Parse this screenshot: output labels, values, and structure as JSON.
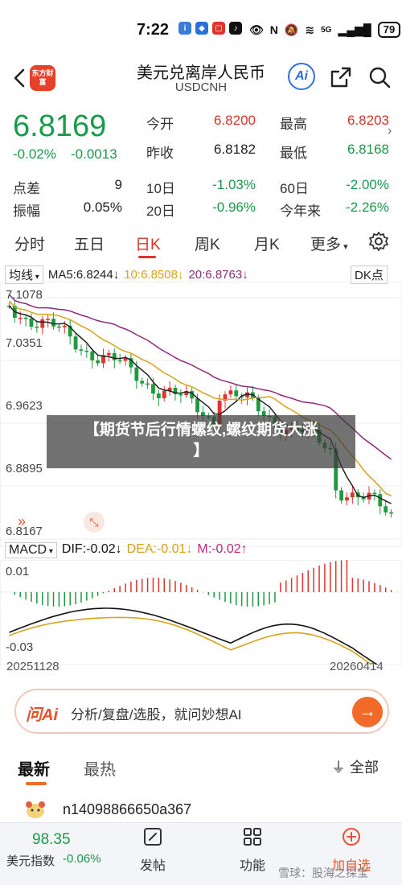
{
  "status_bar": {
    "time": "7:22",
    "signal": "5G",
    "battery": "79"
  },
  "header": {
    "title": "美元兑离岸人民币",
    "symbol": "USDCNH",
    "logo_text": "东方财富",
    "ai_label": "Ai"
  },
  "quote": {
    "price": "6.8169",
    "change_pct": "-0.02%",
    "change_abs": "-0.0013",
    "rows": [
      {
        "label": "今开",
        "value": "6.8200",
        "color": "red",
        "label2": "最高",
        "value2": "6.8203",
        "color2": "red"
      },
      {
        "label": "昨收",
        "value": "6.8182",
        "color": "dark",
        "label2": "最低",
        "value2": "6.8168",
        "color2": "green"
      }
    ],
    "stats": [
      {
        "label": "点差",
        "value": "9",
        "color": "dark",
        "label2": "10日",
        "value2": "-1.03%",
        "color2": "green",
        "label3": "60日",
        "value3": "-2.00%",
        "color3": "green"
      },
      {
        "label": "振幅",
        "value": "0.05%",
        "color": "dark",
        "label2": "20日",
        "value2": "-0.96%",
        "color2": "green",
        "label3": "今年来",
        "value3": "-2.26%",
        "color3": "green"
      }
    ]
  },
  "tabs": {
    "items": [
      "分时",
      "五日",
      "日K",
      "周K",
      "月K",
      "更多"
    ],
    "active": "日K"
  },
  "chart": {
    "ma_selector": "均线",
    "ma5": "MA5:6.8244",
    "ma10": "10:6.8508",
    "ma20": "20:6.8763",
    "dk_button": "DK点",
    "y_labels": [
      "7.1078",
      "7.0351",
      "6.9623",
      "6.8895",
      "6.8167"
    ],
    "macd_selector": "MACD",
    "dif": "DIF:-0.02",
    "dea": "DEA:-0.01",
    "m": "M:-0.02",
    "macd_y_labels": [
      "0.01",
      "-0.03"
    ],
    "date_start": "20251128",
    "date_end": "20260414",
    "colors": {
      "up": "#e0332b",
      "down": "#1f9a3e",
      "ma5": "#222222",
      "ma10": "#d9a21b",
      "ma20": "#8e2a7a"
    }
  },
  "overlay": {
    "line1": "【期货节后行情螺纹,螺纹期货大涨",
    "line2": "】"
  },
  "ai_bar": {
    "logo": "问Ai",
    "text": "分析/复盘/选股，就问妙想AI"
  },
  "feed": {
    "tab_latest": "最新",
    "tab_hot": "最热",
    "filter": "全部",
    "post_user": "n14098866650a367"
  },
  "bottom_bar": {
    "index_value": "98.35",
    "index_name": "美元指数",
    "index_change": "-0.06%",
    "post_label": "发帖",
    "feature_label": "功能",
    "add_label": "加自选",
    "watermark": "雪球：股海之探宝"
  }
}
